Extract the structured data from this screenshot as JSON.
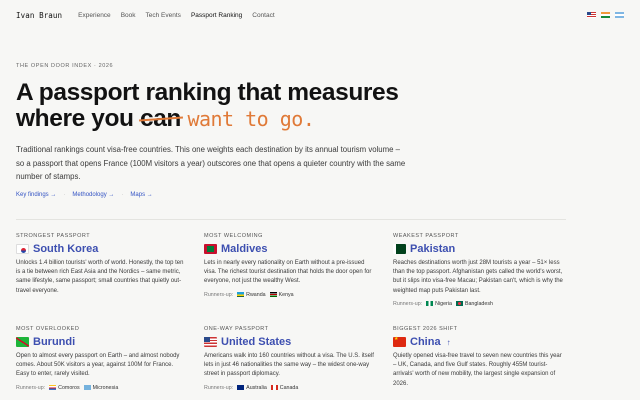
{
  "nav": {
    "brand": "Ivan Braun",
    "links": [
      "Experience",
      "Book",
      "Tech Events",
      "Passport Ranking",
      "Contact"
    ],
    "active": "Passport Ranking",
    "languages": [
      "us-flag-icon",
      "india-flag-icon",
      "argentina-flag-icon"
    ]
  },
  "hero": {
    "eyebrow": "THE OPEN DOOR INDEX · 2026",
    "headline_line1": "A passport ranking that measures",
    "headline_line2_pre": "where you ",
    "headline_struck": "can",
    "headline_handwritten": "want to go.",
    "intro": "Traditional rankings count visa-free countries. This one weights each destination by its annual tourism volume – so a passport that opens France (100M visitors a year) outscores one that opens a quieter country with the same number of stamps.",
    "links": [
      "Key findings →",
      "Methodology →",
      "Maps →"
    ]
  },
  "cards": [
    {
      "label": "STRONGEST PASSPORT",
      "country": "South Korea",
      "flag": "south-korea-flag-icon",
      "description": "Unlocks 1.4 billion tourists' worth of world. Honestly, the top ten is a tie between rich East Asia and the Nordics – same metric, same lifestyle, same passport; small countries that quietly out-travel everyone.",
      "runners_label": "",
      "runners": []
    },
    {
      "label": "MOST WELCOMING",
      "country": "Maldives",
      "flag": "maldives-flag-icon",
      "description": "Lets in nearly every nationality on Earth without a pre-issued visa. The richest tourist destination that holds the door open for everyone, not just the wealthy West.",
      "runners_label": "Runners-up:",
      "runners": [
        "Rwanda",
        "Kenya"
      ]
    },
    {
      "label": "WEAKEST PASSPORT",
      "country": "Pakistan",
      "flag": "pakistan-flag-icon",
      "description": "Reaches destinations worth just 28M tourists a year – 51× less than the top passport. Afghanistan gets called the world's worst, but it slips into visa-free Macau; Pakistan can't, which is why the weighted map puts Pakistan last.",
      "runners_label": "Runners-up:",
      "runners": [
        "Nigeria",
        "Bangladesh"
      ]
    },
    {
      "label": "MOST OVERLOOKED",
      "country": "Burundi",
      "flag": "burundi-flag-icon",
      "description": "Open to almost every passport on Earth – and almost nobody comes. About 50K visitors a year, against 100M for France. Easy to enter, rarely visited.",
      "runners_label": "Runners-up:",
      "runners": [
        "Comoros",
        "Micronesia"
      ]
    },
    {
      "label": "ONE-WAY PASSPORT",
      "country": "United States",
      "flag": "united-states-flag-icon",
      "description": "Americans walk into 160 countries without a visa. The U.S. itself lets in just 46 nationalities the same way – the widest one-way street in passport diplomacy.",
      "runners_label": "Runners-up:",
      "runners": [
        "Australia",
        "Canada"
      ]
    },
    {
      "label": "BIGGEST 2026 SHIFT",
      "country": "China",
      "country_suffix": "↑",
      "flag": "china-flag-icon",
      "description": "Quietly opened visa-free travel to seven new countries this year – UK, Canada, and five Gulf states. Roughly 455M tourist-arrivals' worth of new mobility, the largest single expansion of 2026.",
      "runners_label": "",
      "runners": []
    }
  ]
}
